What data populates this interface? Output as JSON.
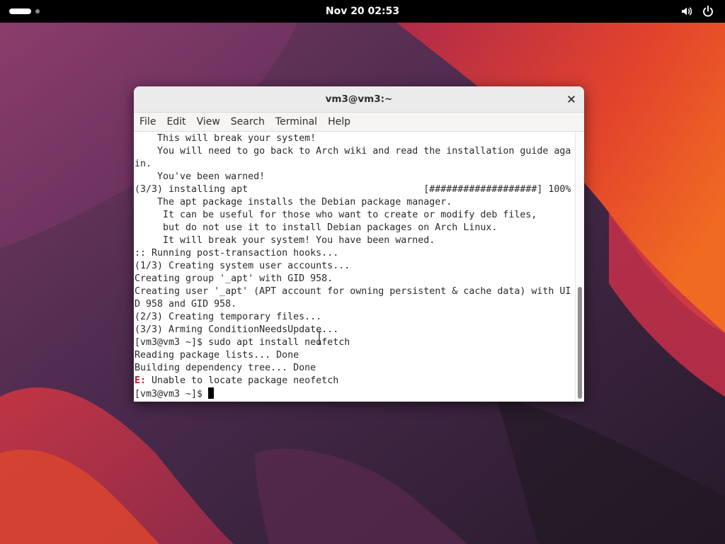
{
  "topbar": {
    "clock": "Nov 20  02:53",
    "icons": [
      "activities-workspace-indicator",
      "volume-icon",
      "power-icon"
    ]
  },
  "window": {
    "title": "vm3@vm3:~",
    "close_icon": "close-icon",
    "menu": [
      "File",
      "Edit",
      "View",
      "Search",
      "Terminal",
      "Help"
    ]
  },
  "terminal": {
    "lines": [
      "    This will break your system!",
      "    You will need to go back to Arch wiki and read the installation guide aga",
      "in.",
      "    You've been warned!",
      "(3/3) installing apt                               [###################] 100%",
      "    The apt package installs the Debian package manager.",
      "     It can be useful for those who want to create or modify deb files,",
      "     but do not use it to install Debian packages on Arch Linux.",
      "     It will break your system! You have been warned.",
      ":: Running post-transaction hooks...",
      "(1/3) Creating system user accounts...",
      "Creating group '_apt' with GID 958.",
      "Creating user '_apt' (APT account for owning persistent & cache data) with UI",
      "D 958 and GID 958.",
      "(2/3) Creating temporary files...",
      "(3/3) Arming ConditionNeedsUpdate...",
      "[vm3@vm3 ~]$ sudo apt install neofetch",
      "Reading package lists... Done",
      "Building dependency tree... Done"
    ],
    "error_prefix": "E:",
    "error_message": " Unable to locate package neofetch",
    "prompt": "[vm3@vm3 ~]$ "
  },
  "colors": {
    "topbar_bg": "#000000",
    "error_red": "#c01c28",
    "wallpaper_accent": "#e8402b",
    "wallpaper_dark": "#2b1a2c"
  }
}
